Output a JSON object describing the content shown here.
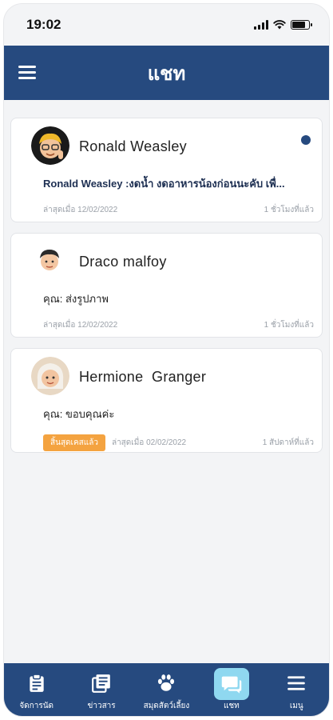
{
  "status_bar": {
    "time": "19:02"
  },
  "header": {
    "title": "แชท"
  },
  "chats": [
    {
      "name": "Ronald Weasley",
      "last_message": "Ronald Weasley :งดน้ำ งดอาหารน้องก่อนนะคับ เพื่...",
      "last_date": "ล่าสุดเมื่อ 12/02/2022",
      "relative_time": "1 ชั่วโมงที่แล้ว",
      "unread": true,
      "avatar": "ronald-avatar"
    },
    {
      "name": "Draco malfoy",
      "last_message": "คุณ: ส่งรูปภาพ",
      "last_date": "ล่าสุดเมื่อ 12/02/2022",
      "relative_time": "1 ชั่วโมงที่แล้ว",
      "unread": false,
      "avatar": "draco-avatar"
    },
    {
      "name": "Hermione  Granger",
      "last_message": "คุณ: ขอบคุณค่ะ",
      "badge": "สิ้นสุดเคสแล้ว",
      "last_date": "ล่าสุดเมื่อ 02/02/2022",
      "relative_time": "1 สัปดาห์ที่แล้ว",
      "unread": false,
      "avatar": "hermione-avatar"
    }
  ],
  "bottom_nav": [
    {
      "label": "จัดการนัด",
      "icon": "clipboard-icon"
    },
    {
      "label": "ข่าวสาร",
      "icon": "news-icon"
    },
    {
      "label": "สมุดสัตว์เลี้ยง",
      "icon": "paw-icon"
    },
    {
      "label": "แชท",
      "icon": "chat-icon",
      "active": true
    },
    {
      "label": "เมนู",
      "icon": "menu-icon"
    }
  ],
  "colors": {
    "primary": "#264a7f",
    "accent": "#8fd8f0",
    "badge": "#f4a340"
  }
}
